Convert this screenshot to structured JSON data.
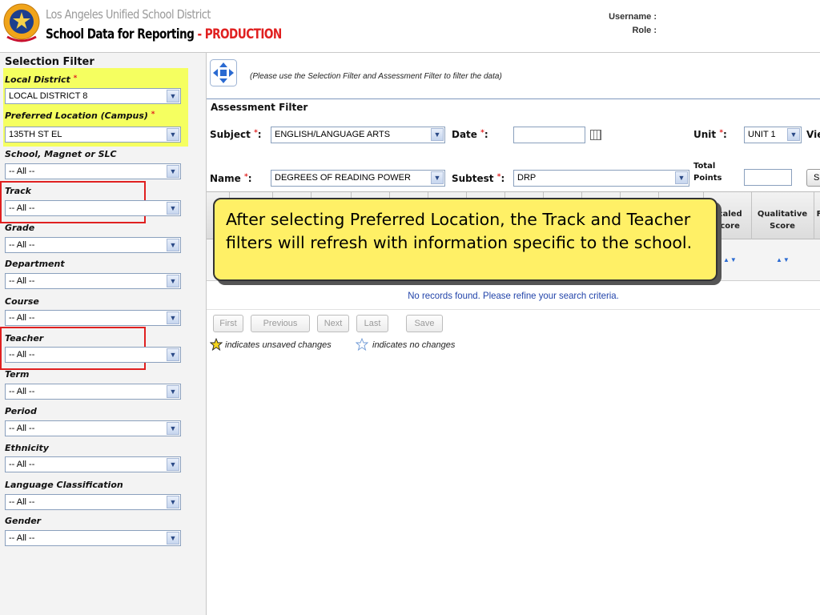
{
  "header": {
    "district_name": "Los Angeles Unified School District",
    "app_name": "School Data for Reporting",
    "separator": " - ",
    "environment": "PRODUCTION",
    "username_label": "Username :",
    "role_label": "Role :",
    "brand_color": "#e02020"
  },
  "sidebar": {
    "title": "Selection Filter",
    "required_mark": "*",
    "filters": [
      {
        "label": "Local District",
        "value": "LOCAL DISTRICT 8"
      },
      {
        "label": "Preferred Location (Campus)",
        "value": "135TH ST EL"
      },
      {
        "label": "School, Magnet or SLC",
        "value": "-- All --"
      },
      {
        "label": "Track",
        "value": "-- All --"
      },
      {
        "label": "Grade",
        "value": "-- All --"
      },
      {
        "label": "Department",
        "value": "-- All --"
      },
      {
        "label": "Course",
        "value": "-- All --"
      },
      {
        "label": "Teacher",
        "value": "-- All --"
      },
      {
        "label": "Term",
        "value": "-- All --"
      },
      {
        "label": "Period",
        "value": "-- All --"
      },
      {
        "label": "Ethnicity",
        "value": "-- All --"
      },
      {
        "label": "Language Classification",
        "value": "-- All --"
      },
      {
        "label": "Gender",
        "value": "-- All --"
      }
    ],
    "highlight_color": "#f5ff60"
  },
  "main": {
    "hint": "(Please use the Selection Filter and Assessment Filter to filter the data)",
    "assessment_filter": {
      "title": "Assessment Filter",
      "subject_label": "Subject",
      "subject_value": "ENGLISH/LANGUAGE ARTS",
      "date_label": "Date",
      "date_value": "",
      "unit_label": "Unit",
      "unit_value": "UNIT 1",
      "view_label": "Vie",
      "name_label": "Name",
      "name_value": "DEGREES OF READING POWER",
      "subtest_label": "Subtest",
      "subtest_value": "DRP",
      "total_points_label_1": "Total",
      "total_points_label_2": "Points",
      "total_points_value": "",
      "button_label": "S",
      "colon": ":"
    },
    "grid": {
      "col_scaled_1": "Scaled",
      "col_scaled_2": "Score",
      "col_qualitative_1": "Qualitative",
      "col_qualitative_2": "Score",
      "col_cut": "F",
      "sort_icon": "▲▼"
    },
    "no_records": "No records found. Please refine your search criteria.",
    "pager": {
      "first": "First",
      "previous": "Previous",
      "next": "Next",
      "last": "Last",
      "save": "Save"
    },
    "legend_unsaved": "indicates unsaved changes",
    "legend_nochange": "indicates no changes"
  },
  "callout": {
    "text": "After selecting Preferred Location, the Track and Teacher filters will refresh with information specific to the school."
  }
}
